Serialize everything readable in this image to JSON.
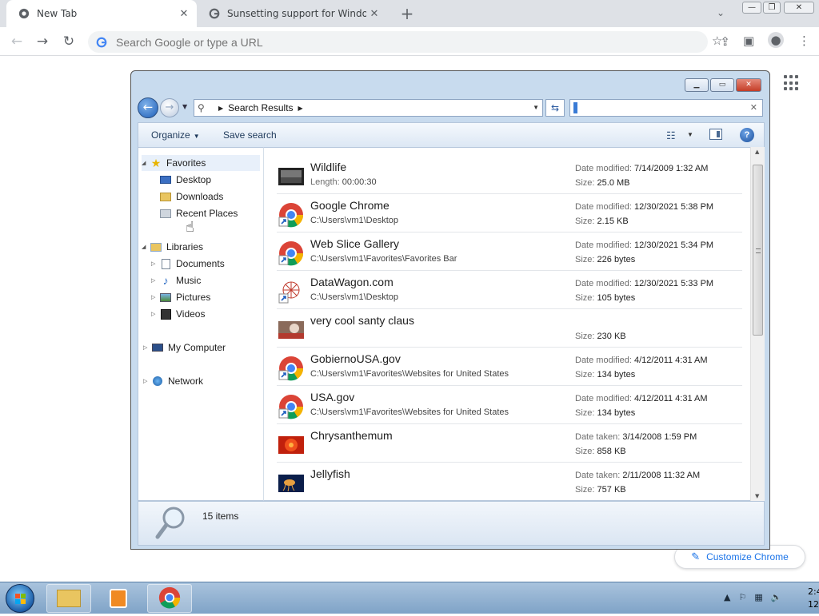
{
  "browser": {
    "tabs": [
      {
        "label": "New Tab",
        "close": "✕"
      },
      {
        "label": "Sunsetting support for Windows",
        "close": "✕"
      }
    ],
    "new_tab": "+",
    "tab_search": "⌄",
    "window_controls": {
      "minimize": "—",
      "restore": "❐",
      "close": "✕"
    },
    "omnibox_placeholder": "Search Google or type a URL",
    "customize_label": "Customize Chrome"
  },
  "explorer": {
    "breadcrumb": "Search Results",
    "command_bar": {
      "organize": "Organize",
      "save_search": "Save search",
      "help": "?"
    },
    "nav": {
      "favorites": "Favorites",
      "desktop": "Desktop",
      "downloads": "Downloads",
      "recent": "Recent Places",
      "libraries": "Libraries",
      "documents": "Documents",
      "music": "Music",
      "pictures": "Pictures",
      "videos": "Videos",
      "computer": "My Computer",
      "network": "Network"
    },
    "results": [
      {
        "name": "Wildlife",
        "sub_key": "Length:",
        "sub_val": "00:00:30",
        "m1_key": "Date modified:",
        "m1_val": "7/14/2009 1:32 AM",
        "m2_key": "Size:",
        "m2_val": "25.0 MB"
      },
      {
        "name": "Google Chrome",
        "sub_key": "",
        "sub_val": "C:\\Users\\vm1\\Desktop",
        "m1_key": "Date modified:",
        "m1_val": "12/30/2021 5:38 PM",
        "m2_key": "Size:",
        "m2_val": "2.15 KB"
      },
      {
        "name": "Web Slice Gallery",
        "sub_key": "",
        "sub_val": "C:\\Users\\vm1\\Favorites\\Favorites Bar",
        "m1_key": "Date modified:",
        "m1_val": "12/30/2021 5:34 PM",
        "m2_key": "Size:",
        "m2_val": "226 bytes"
      },
      {
        "name": "DataWagon.com",
        "sub_key": "",
        "sub_val": "C:\\Users\\vm1\\Desktop",
        "m1_key": "Date modified:",
        "m1_val": "12/30/2021 5:33 PM",
        "m2_key": "Size:",
        "m2_val": "105 bytes"
      },
      {
        "name": "very cool santy claus",
        "sub_key": "",
        "sub_val": "",
        "m1_key": "",
        "m1_val": "",
        "m2_key": "Size:",
        "m2_val": "230 KB"
      },
      {
        "name": "GobiernoUSA.gov",
        "sub_key": "",
        "sub_val": "C:\\Users\\vm1\\Favorites\\Websites for United States",
        "m1_key": "Date modified:",
        "m1_val": "4/12/2011 4:31 AM",
        "m2_key": "Size:",
        "m2_val": "134 bytes"
      },
      {
        "name": "USA.gov",
        "sub_key": "",
        "sub_val": "C:\\Users\\vm1\\Favorites\\Websites for United States",
        "m1_key": "Date modified:",
        "m1_val": "4/12/2011 4:31 AM",
        "m2_key": "Size:",
        "m2_val": "134 bytes"
      },
      {
        "name": "Chrysanthemum",
        "sub_key": "",
        "sub_val": "",
        "m1_key": "Date taken:",
        "m1_val": "3/14/2008 1:59 PM",
        "m2_key": "Size:",
        "m2_val": "858 KB"
      },
      {
        "name": "Jellyfish",
        "sub_key": "",
        "sub_val": "",
        "m1_key": "Date taken:",
        "m1_val": "2/11/2008 11:32 AM",
        "m2_key": "Size:",
        "m2_val": "757 KB"
      }
    ],
    "item_count": "15 items"
  },
  "taskbar": {
    "clock_time": "2:4",
    "clock_date": "12/"
  }
}
